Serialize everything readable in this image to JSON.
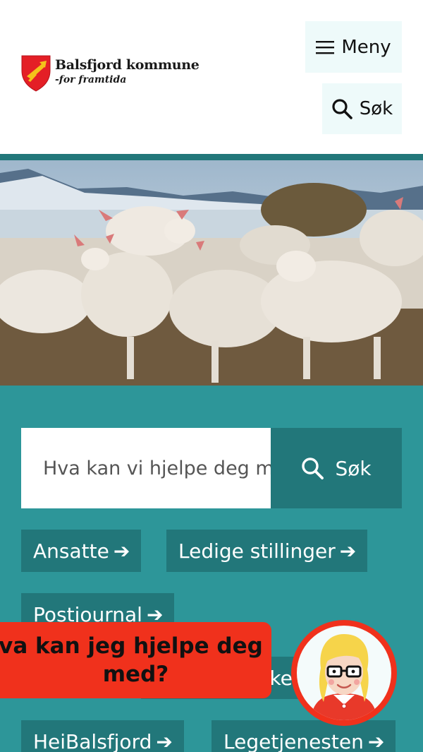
{
  "header": {
    "logo_name": "Balsfjord kommune",
    "logo_tagline": "-for framtida",
    "menu_label": "Meny",
    "search_label": "Søk"
  },
  "search": {
    "placeholder": "Hva kan vi hjelpe deg med?",
    "submit_label": "Søk"
  },
  "quick_links": [
    {
      "label": "Ansatte"
    },
    {
      "label": "Ledige stillinger"
    },
    {
      "label": "Postjournal"
    },
    {
      "label": "Møter og saker"
    },
    {
      "label": "HeiBalsfjord"
    },
    {
      "label": "Legetjenesten"
    }
  ],
  "chat": {
    "line1": "Hva kan jeg hjelpe deg",
    "line2": "med?"
  },
  "colors": {
    "teal_dark": "#22777a",
    "teal": "#2d9699",
    "chat_red": "#f0311c",
    "header_button_bg": "#eefafa"
  }
}
